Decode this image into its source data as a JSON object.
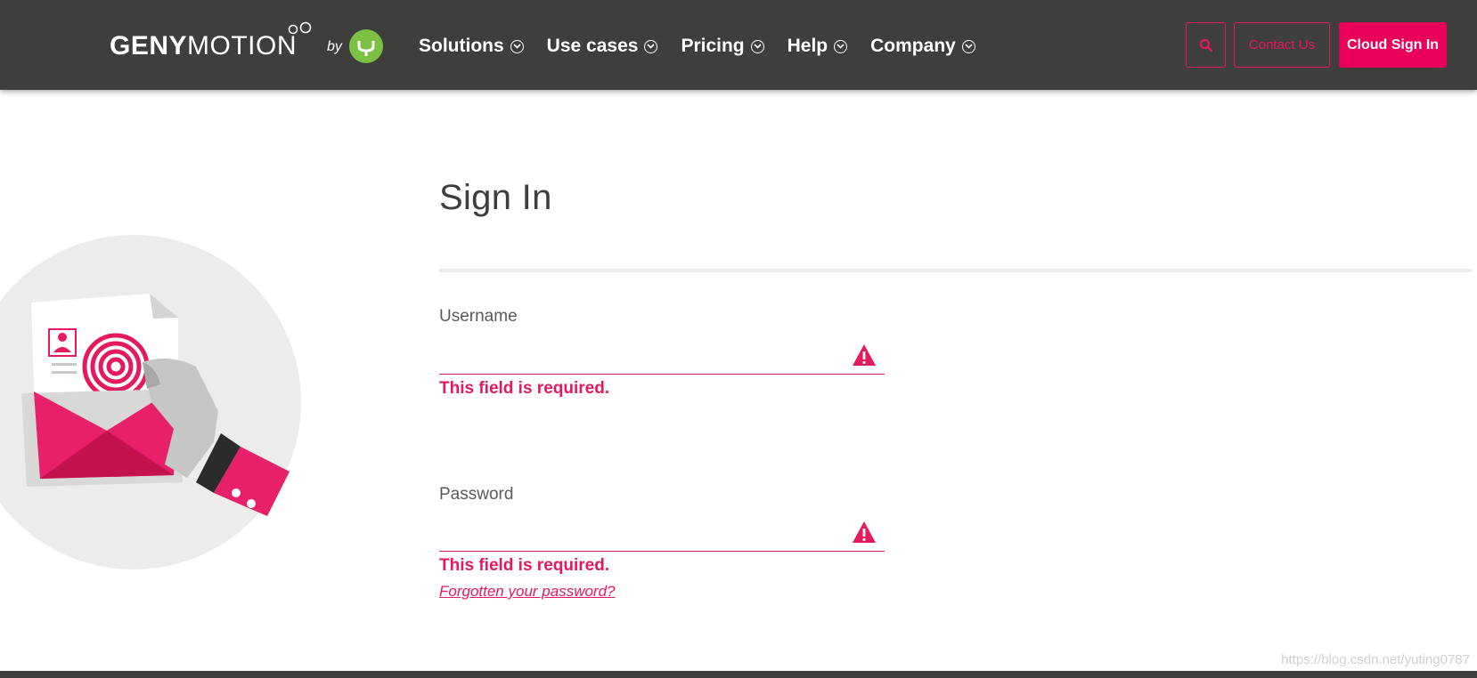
{
  "brand": {
    "name_bold": "GENY",
    "name_light": "MOTION",
    "by_text": "by",
    "colors": {
      "topbar": "#3e3e3c",
      "accent": "#e8005a",
      "badge": "#7cc142"
    }
  },
  "nav": {
    "items": [
      {
        "label": "Solutions",
        "icon": "chevron-down-circle-icon"
      },
      {
        "label": "Use cases",
        "icon": "chevron-down-circle-icon"
      },
      {
        "label": "Pricing",
        "icon": "chevron-down-circle-icon"
      },
      {
        "label": "Help",
        "icon": "chevron-down-circle-icon"
      },
      {
        "label": "Company",
        "icon": "chevron-down-circle-icon"
      }
    ],
    "search_icon": "search-icon",
    "contact_label": "Contact Us",
    "cloud_signin_label": "Cloud Sign In"
  },
  "form": {
    "title": "Sign In",
    "username": {
      "label": "Username",
      "value": "",
      "error": "This field is required."
    },
    "password": {
      "label": "Password",
      "value": "",
      "error": "This field is required."
    },
    "forgot_label": "Forgotten your password?"
  },
  "watermark": "https://blog.csdn.net/yuting0787"
}
